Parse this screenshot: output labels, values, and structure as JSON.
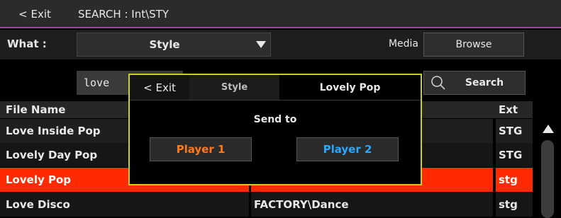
{
  "top_bar": {
    "exit_label": "< Exit",
    "title": "SEARCH : Int\\STY",
    "accent": "#b23ab8"
  },
  "what_row": {
    "label": "What :",
    "selected": "Style",
    "media_label": "Media",
    "browse_label": "Browse"
  },
  "search_row": {
    "query": "love",
    "search_label": "Search"
  },
  "table": {
    "headers": {
      "file_name": "File Name",
      "ext": "Ext"
    },
    "rows": [
      {
        "name": "Love Inside Pop",
        "folder": "",
        "ext": "STG"
      },
      {
        "name": "Lovely Day Pop",
        "folder": "",
        "ext": "STG"
      },
      {
        "name": "Lovely Pop",
        "folder": "",
        "ext": "stg",
        "selected": true
      },
      {
        "name": "Love Disco",
        "folder": "FACTORY\\Dance",
        "ext": "stg"
      }
    ],
    "selected_color": "#ff2a00"
  },
  "dialog": {
    "exit_label": "< Exit",
    "type_label": "Style",
    "item_name": "Lovely Pop",
    "send_to_label": "Send to",
    "player1_label": "Player 1",
    "player2_label": "Player 2",
    "border_color": "#c9d21a",
    "player1_color": "#ff7a1a",
    "player2_color": "#2aa8ff"
  },
  "icons": {
    "dropdown": "triangle-down-icon",
    "search": "magnifier-icon",
    "scroll_up": "triangle-up-icon"
  }
}
